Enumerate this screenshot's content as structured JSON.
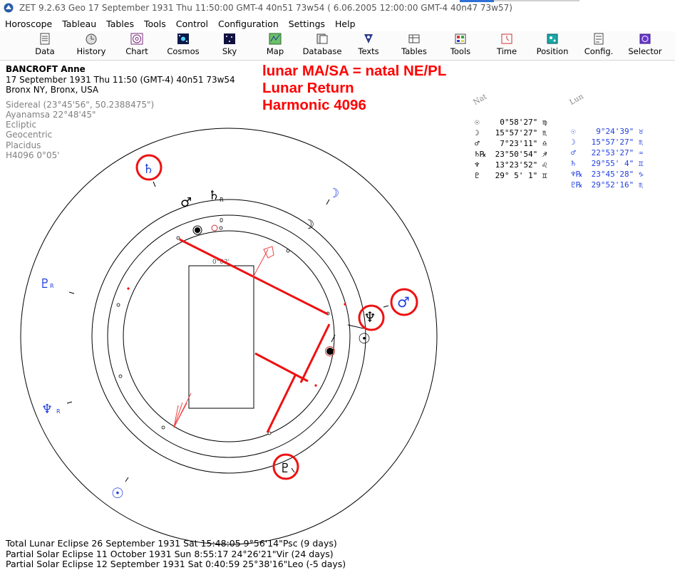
{
  "window": {
    "title": "ZET 9.2.63 Geo   17 September 1931  Thu  11:50:00 GMT-4 40n51  73w54  ( 6.06.2005  12:00:00 GMT-4 40n47 73w57)"
  },
  "menu": {
    "items": [
      "Horoscope",
      "Tableau",
      "Tables",
      "Tools",
      "Control",
      "Configuration",
      "Settings",
      "Help"
    ]
  },
  "toolbar": {
    "buttons": [
      {
        "label": "Data",
        "icon": "data-icon"
      },
      {
        "label": "History",
        "icon": "history-icon"
      },
      {
        "label": "Chart",
        "icon": "chart-icon"
      },
      {
        "label": "Cosmos",
        "icon": "cosmos-icon"
      },
      {
        "label": "Sky",
        "icon": "sky-icon"
      },
      {
        "label": "Map",
        "icon": "map-icon"
      },
      {
        "label": "Database",
        "icon": "database-icon"
      },
      {
        "label": "Texts",
        "icon": "texts-icon"
      },
      {
        "label": "Tables",
        "icon": "tables-icon"
      },
      {
        "label": "Tools",
        "icon": "tools-icon"
      },
      {
        "label": "Time",
        "icon": "time-icon"
      },
      {
        "label": "Position",
        "icon": "position-icon"
      },
      {
        "label": "Config.",
        "icon": "config-icon"
      },
      {
        "label": "Selector",
        "icon": "selector-icon"
      }
    ]
  },
  "info": {
    "name": "BANCROFT Anne",
    "datetime": "17 September 1931  Thu  11:50 (GMT-4) 40n51  73w54",
    "place": "Bronx NY, Bronx, USA",
    "settings": [
      "Sidereal (23°45'56\", 50.2388475\")",
      "Ayanamsa 22°48'45\"",
      "Ecliptic",
      "Geocentric",
      "Placidus",
      "H4096   0°05'"
    ]
  },
  "annotation": {
    "lines": [
      "lunar MA/SA = natal NE/PL",
      "Lunar Return",
      "Harmonic 4096"
    ],
    "color": "#ff0000"
  },
  "positions": {
    "nat_header": "Nat",
    "lun_header": "Lun",
    "rows": [
      {
        "nat_sym": "☉",
        "nat": "  0°58'27\" ♍",
        "lun_sym": "☉",
        "lun": "  9°24'39\" ♉"
      },
      {
        "nat_sym": "☽",
        "nat": " 15°57'27\" ♏",
        "lun_sym": "☽",
        "lun": " 15°57'27\" ♏"
      },
      {
        "nat_sym": "♂",
        "nat": "  7°23'11\" ♎",
        "lun_sym": "♂",
        "lun": " 22°53'27\" ♒"
      },
      {
        "nat_sym": "♄℞",
        "nat": " 23°50'54\" ♐",
        "lun_sym": "♄",
        "lun": " 29°55' 4\" ♊"
      },
      {
        "nat_sym": "♆",
        "nat": " 13°23'52\" ♌",
        "lun_sym": "♆℞",
        "lun": " 23°45'28\" ♑"
      },
      {
        "nat_sym": "♇",
        "nat": " 29° 5' 1\" ♊",
        "lun_sym": "♇℞",
        "lun": " 29°52'16\" ♏"
      }
    ],
    "nat_color": "#000000",
    "lun_color": "#1f3fe0"
  },
  "chart": {
    "center_label": "0°02'",
    "zero_label": "0",
    "retro_mark": "R"
  },
  "eclipses": [
    "Total Lunar Eclipse 26 September 1931 Sat 15:48:05  9°56'14\"Psc (9 days)",
    "Partial Solar Eclipse 11 October 1931 Sun  8:55:17 24°26'21\"Vir (24 days)",
    "Partial Solar Eclipse 12 September 1931 Sat  0:40:59 25°38'16\"Leo (-5 days)"
  ]
}
